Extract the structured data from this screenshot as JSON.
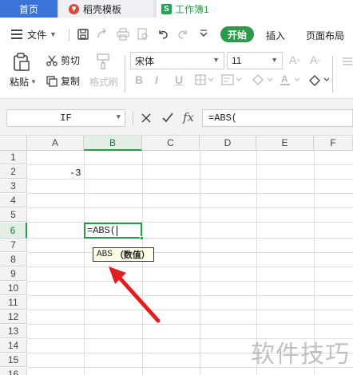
{
  "tabs": {
    "home": "首页",
    "template": "稻壳模板",
    "doc": "工作簿1",
    "doc_icon_letter": "S"
  },
  "menu": {
    "file": "文件",
    "start": "开始",
    "insert": "插入",
    "page_layout": "页面布局"
  },
  "ribbon": {
    "paste": "粘贴",
    "cut": "剪切",
    "copy": "复制",
    "format_painter": "格式刷",
    "font_name": "宋体",
    "font_size": "11",
    "bold": "B",
    "italic": "I",
    "underline": "U"
  },
  "formula_bar": {
    "name_box": "IF",
    "fx": "fx",
    "content": "=ABS("
  },
  "grid": {
    "columns": [
      "A",
      "B",
      "C",
      "D",
      "E",
      "F"
    ],
    "active_column": "B",
    "rows": [
      "1",
      "2",
      "3",
      "4",
      "5",
      "6",
      "7",
      "8",
      "9",
      "10",
      "11",
      "12",
      "13",
      "14",
      "15",
      "16"
    ],
    "active_row": "6",
    "cells": {
      "A2": "-3",
      "B6": "=ABS("
    },
    "tooltip": {
      "func": "ABS",
      "arg": "（数值）"
    }
  },
  "watermark": "软件技巧",
  "colors": {
    "accent_green": "#2c9a4a",
    "home_tab_blue": "#3b74d8",
    "arrow_red": "#e02020"
  }
}
